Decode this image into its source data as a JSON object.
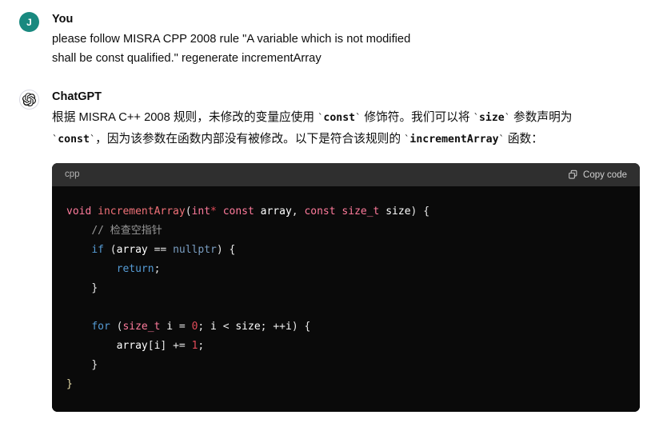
{
  "conversation": {
    "user": {
      "avatar_initial": "J",
      "avatar_color": "#19897f",
      "author": "You",
      "text": "please follow MISRA CPP 2008 rule \"A variable which is not modified\nshall be const qualified.\" regenerate incrementArray"
    },
    "assistant": {
      "author": "ChatGPT",
      "avatar_icon": "openai-logo-icon",
      "paragraph": {
        "seg1": "根据 MISRA C++ 2008 规则，未修改的变量应使用 ",
        "code1": "const",
        "seg2": " 修饰符。我们可以将 ",
        "code2": "size",
        "seg3": " 参数声明为 ",
        "code3": "const",
        "seg4": "，因为该参数在函数内部没有被修改。以下是符合该规则的 ",
        "code4": "incrementArray",
        "seg5": " 函数："
      },
      "code_block": {
        "language": "cpp",
        "copy_label": "Copy code",
        "copy_icon": "copy-icon",
        "code_text": "void incrementArray(int* const array, const size_t size) {\n    // 检查空指针\n    if (array == nullptr) {\n        return;\n    }\n\n    for (size_t i = 0; i < size; ++i) {\n        array[i] += 1;\n    }\n}"
      }
    }
  },
  "colors": {
    "page_background": "#ffffff",
    "code_header_background": "#2f2f2f",
    "code_body_background": "#0a0a0a",
    "user_avatar": "#19897f",
    "keyword": "#ff7b9c",
    "function": "#f07178",
    "control": "#569cd6",
    "number": "#e24b59",
    "comment": "#9a9a9a"
  }
}
